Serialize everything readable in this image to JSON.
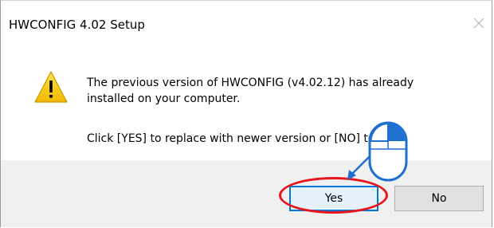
{
  "dialog": {
    "title": "HWCONFIG 4.02 Setup",
    "close_icon": "close-icon",
    "warning_icon": "warning-triangle-icon",
    "message_line1": "The previous version of HWCONFIG (v4.02.12) has already",
    "message_line2": "installed on your computer.",
    "message_line3": "Click [YES] to replace with newer version or [NO] to quit."
  },
  "buttons": {
    "yes_label": "Yes",
    "no_label": "No"
  },
  "annotation": {
    "mouse_icon": "mouse-click-icon",
    "highlight": "red-ellipse-highlight",
    "arrow_color": "#1f6fd1",
    "highlight_color": "#e8131b"
  },
  "colors": {
    "footer_bg": "#f0f0f0",
    "default_button_border": "#0078d7",
    "warning_yellow": "#f5c400"
  }
}
